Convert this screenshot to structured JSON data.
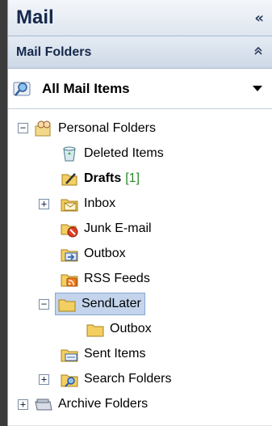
{
  "pane": {
    "title": "Mail",
    "collapse_glyph": "«"
  },
  "section": {
    "title": "Mail Folders",
    "toggle_glyph": "⌃"
  },
  "mail_items": {
    "label": "All Mail Items",
    "icon": "search-folder-icon"
  },
  "tree": {
    "personal_folders": "Personal Folders",
    "deleted_items": "Deleted Items",
    "drafts": "Drafts",
    "drafts_count": "[1]",
    "inbox": "Inbox",
    "junk": "Junk E-mail",
    "outbox": "Outbox",
    "rss": "RSS Feeds",
    "sendlater": "SendLater",
    "sendlater_outbox": "Outbox",
    "sent": "Sent Items",
    "search_folders": "Search Folders",
    "archive": "Archive Folders"
  },
  "expanders": {
    "minus": "−",
    "plus": "+"
  },
  "colors": {
    "selection": "#c3d4ec",
    "count_green": "#2c8a2c",
    "header_text": "#15284b"
  }
}
